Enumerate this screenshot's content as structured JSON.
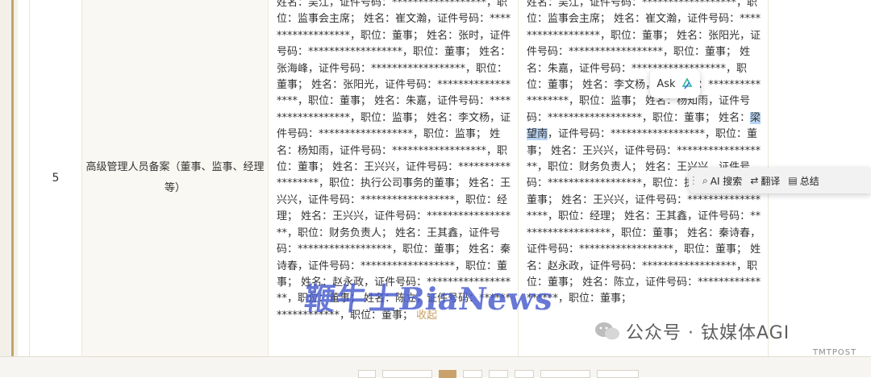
{
  "row": {
    "index": "5",
    "category": "高级管理人员备案（董事、监事、经理等）",
    "before_text": "姓名：吴江，证件号码：******************，职位：监事会主席； 姓名：崔文瀚，证件号码：******************，职位：董事； 姓名：张时，证件号码：******************，职位：董事； 姓名：张海峰，证件号码：******************，职位：董事； 姓名：张阳光，证件号码：******************，职位：董事； 姓名：朱嘉，证件号码：******************，职位：监事； 姓名：李文杨，证件号码：******************，职位：监事； 姓名：杨知雨，证件号码：******************，职位：董事； 姓名：王兴兴，证件号码：******************，职位：执行公司事务的董事； 姓名：王兴兴，证件号码：******************，职位：经理； 姓名：王兴兴，证件号码：******************，职位：财务负责人； 姓名：王其鑫，证件号码：******************，职位：董事； 姓名：秦诗春，证件号码：******************，职位：董事； 姓名：赵永政，证件号码：******************，职位：董事； 姓名：陈立，证件号码：******************，职位：董事；",
    "collapse_label": "收起",
    "after_text_a": "姓名：吴江，证件号码：******************，职位：监事会主席； 姓名：崔文瀚，证件号码：******************，职位：董事； 姓名：张阳光，证件号码：******************，职位：董事； 姓名：朱嘉，证件号码：******************，职位：董事； 姓名：李文杨，证件号码：******************，职位：监事； 姓名：杨知雨，证件号码：******************，职位：董事； 姓名：",
    "after_highlight": "梁望南",
    "after_text_b": "，证件号码：******************，职位：董事； 姓名：王兴兴，证件号码：******************，职位：财务负责人； 姓名：王兴兴，证件号码：******************，职位：执行公司事务的董事； 姓名：王兴兴，证件号码：******************，职位：经理； 姓名：王其鑫，证件号码：******************，职位：董事； 姓名：秦诗春，证件号码：******************，职位：董事； 姓名：赵永政，证件号码：******************，职位：董事； 姓名：陈立，证件号码：******************，职位：董事；"
  },
  "watermark": "鞭牛士BiaNews",
  "ask_popup": {
    "label": "Ask"
  },
  "selection_toolbar": {
    "ai_search": "AI 搜索",
    "translate": "翻译",
    "summarize": "总结"
  },
  "brand": {
    "text": "公众号 · 钛媒体AGI",
    "sub": "TMTPOST"
  },
  "colors": {
    "accent_gold": "#c2a46a",
    "collapse_link": "#c8a063",
    "highlight": "#b9d4f5",
    "watermark": "#4658cd"
  },
  "icons": [
    "ask-logo-icon",
    "grip-icon",
    "ai-search-icon",
    "translate-icon",
    "summarize-icon",
    "wechat-brand-icon"
  ]
}
